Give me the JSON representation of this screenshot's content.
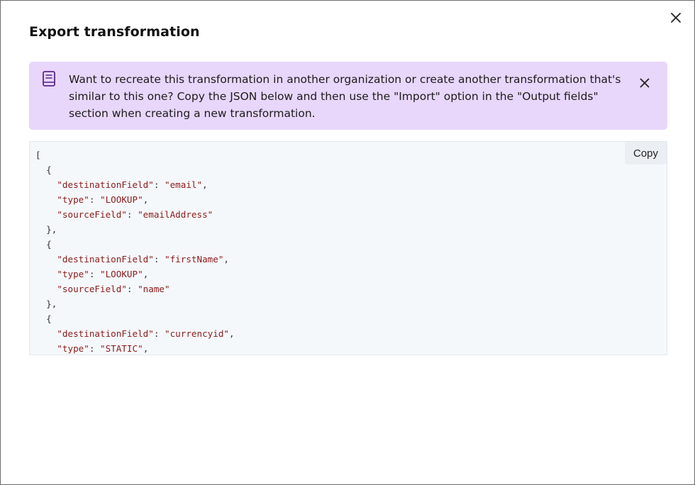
{
  "dialog": {
    "title": "Export transformation",
    "close_icon": "close-icon"
  },
  "banner": {
    "icon": "book-icon",
    "text": "Want to recreate this transformation in another organization or create another transformation that's similar to this one? Copy the JSON below and then use the \"Import\" option in the \"Output fields\" section when creating a new transformation.",
    "close_icon": "close-icon",
    "background_color": "#e8d6fb"
  },
  "code": {
    "copy_label": "Copy",
    "lines": [
      {
        "indent": "",
        "text": "["
      },
      {
        "indent": "  ",
        "text": "{"
      },
      {
        "indent": "    ",
        "key": "\"destinationField\"",
        "value": "\"email\"",
        "trail": ","
      },
      {
        "indent": "    ",
        "key": "\"type\"",
        "value": "\"LOOKUP\"",
        "trail": ","
      },
      {
        "indent": "    ",
        "key": "\"sourceField\"",
        "value": "\"emailAddress\"",
        "trail": ""
      },
      {
        "indent": "  ",
        "text": "},"
      },
      {
        "indent": "  ",
        "text": "{"
      },
      {
        "indent": "    ",
        "key": "\"destinationField\"",
        "value": "\"firstName\"",
        "trail": ","
      },
      {
        "indent": "    ",
        "key": "\"type\"",
        "value": "\"LOOKUP\"",
        "trail": ","
      },
      {
        "indent": "    ",
        "key": "\"sourceField\"",
        "value": "\"name\"",
        "trail": ""
      },
      {
        "indent": "  ",
        "text": "},"
      },
      {
        "indent": "  ",
        "text": "{"
      },
      {
        "indent": "    ",
        "key": "\"destinationField\"",
        "value": "\"currencyid\"",
        "trail": ","
      },
      {
        "indent": "    ",
        "key": "\"type\"",
        "value": "\"STATIC\"",
        "trail": ","
      }
    ],
    "key_color": "#8b1a1a",
    "value_color": "#8b1a1a"
  }
}
